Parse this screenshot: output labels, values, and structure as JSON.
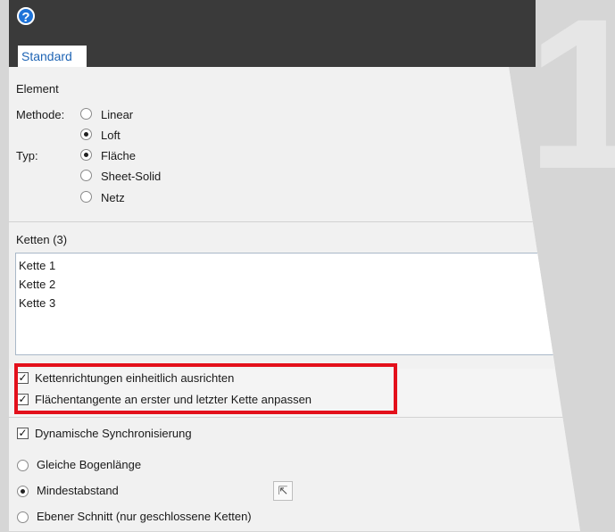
{
  "app": {
    "help_label": "?",
    "background_digit": "1"
  },
  "tabs": [
    {
      "label": "Standard",
      "active": true
    }
  ],
  "element_section": {
    "title": "Element",
    "method_label": "Methode:",
    "method_options": [
      {
        "label": "Linear",
        "selected": false
      },
      {
        "label": "Loft",
        "selected": true
      }
    ],
    "type_label": "Typ:",
    "type_options": [
      {
        "label": "Fläche",
        "selected": true
      },
      {
        "label": "Sheet-Solid",
        "selected": false
      },
      {
        "label": "Netz",
        "selected": false
      }
    ]
  },
  "chains_section": {
    "title": "Ketten (3)",
    "items": [
      "Kette  1",
      "Kette  2",
      "Kette  3"
    ]
  },
  "options": {
    "align_chain_directions": {
      "label": "Kettenrichtungen einheitlich ausrichten",
      "checked": true
    },
    "match_surface_tangent": {
      "label": "Flächentangente an erster und letzter Kette anpassen",
      "checked": true
    },
    "dynamic_sync": {
      "label": "Dynamische Synchronisierung",
      "checked": true
    }
  },
  "sync_modes": [
    {
      "label": "Gleiche Bogenlänge",
      "selected": false
    },
    {
      "label": "Mindestabstand",
      "selected": true
    },
    {
      "label": "Ebener Schnitt (nur geschlossene Ketten)",
      "selected": false
    }
  ],
  "pick_button_icon": "cursor-arrow-icon",
  "colors": {
    "highlight_border": "#e3101b",
    "header_bg": "#3a3a3a",
    "tab_text": "#1e64b4",
    "help_icon": "#1e73d8"
  }
}
